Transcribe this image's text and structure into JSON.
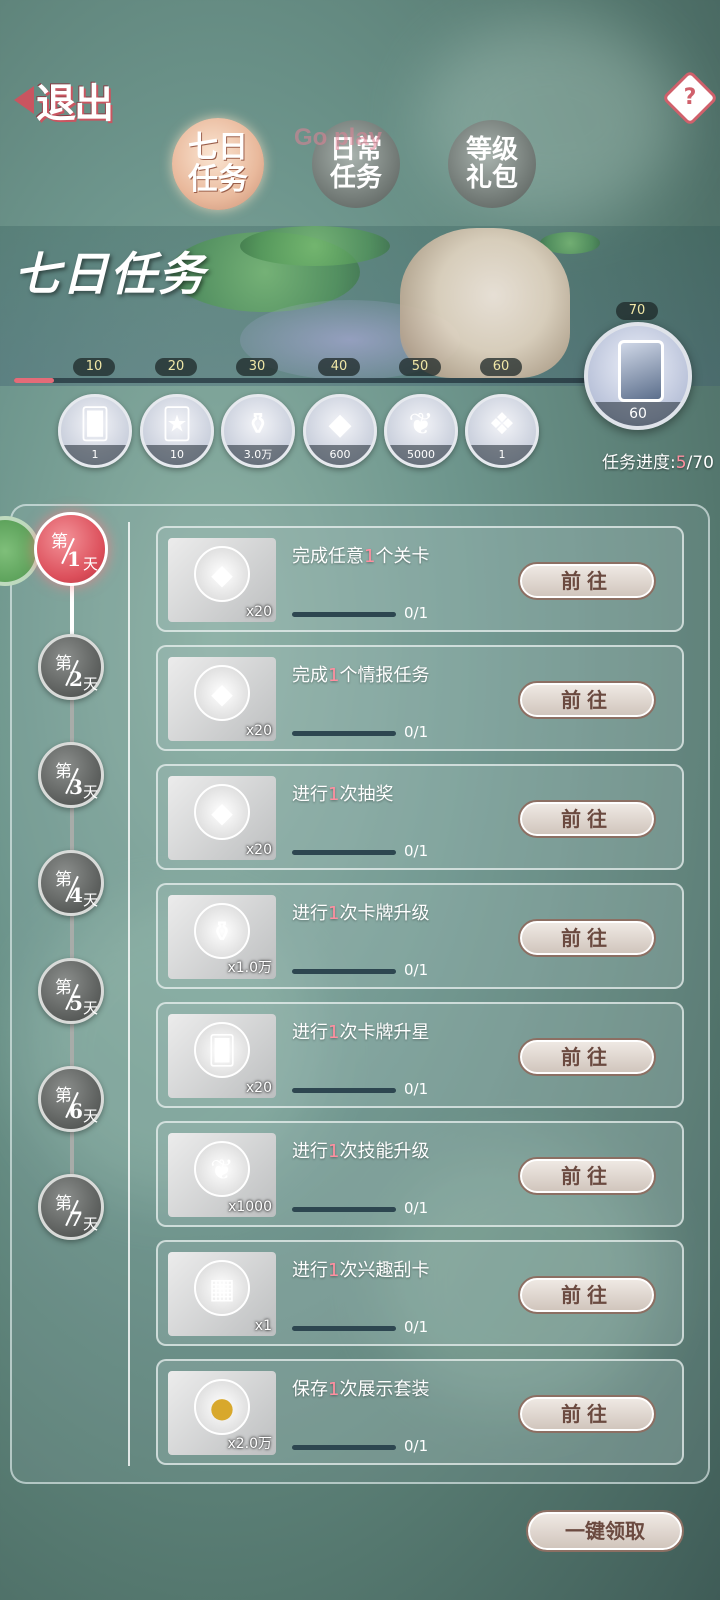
{
  "header": {
    "exit_label": "退出",
    "tabs": [
      {
        "label_line1": "七日",
        "label_line2": "任务",
        "active": true
      },
      {
        "label_line1": "日常",
        "label_line2": "任务",
        "active": false
      },
      {
        "label_line1": "等级",
        "label_line2": "礼包",
        "active": false
      }
    ],
    "watermark": "Go play",
    "help_icon": "?"
  },
  "banner": {
    "title": "七日任务",
    "milestones": [
      "10",
      "20",
      "30",
      "40",
      "50",
      "60"
    ],
    "final_milestone": "70",
    "progress_fraction": 0.07,
    "rewards": [
      {
        "icon": "card-icon",
        "count": "1"
      },
      {
        "icon": "tarot-card-icon",
        "count": "10"
      },
      {
        "icon": "perfume-bottle-icon",
        "count": "3.0万"
      },
      {
        "icon": "crystal-shoe-icon",
        "count": "600"
      },
      {
        "icon": "dragon-icon",
        "count": "5000"
      },
      {
        "icon": "outfit-icon",
        "count": "1"
      }
    ],
    "final_reward": {
      "icon": "card-pack-icon",
      "count": "60"
    },
    "progress_text_prefix": "任务进度:",
    "progress_current": "5",
    "progress_total": "/70"
  },
  "days": [
    {
      "di": "第",
      "num": "1",
      "tian": "天",
      "active": true
    },
    {
      "di": "第",
      "num": "2",
      "tian": "天",
      "active": false
    },
    {
      "di": "第",
      "num": "3",
      "tian": "天",
      "active": false
    },
    {
      "di": "第",
      "num": "4",
      "tian": "天",
      "active": false
    },
    {
      "di": "第",
      "num": "5",
      "tian": "天",
      "active": false
    },
    {
      "di": "第",
      "num": "6",
      "tian": "天",
      "active": false
    },
    {
      "di": "第",
      "num": "7",
      "tian": "天",
      "active": false
    }
  ],
  "tasks": [
    {
      "pre": "完成任意",
      "num": "1",
      "post": "个关卡",
      "qty": "x20",
      "icon": "crystal-shoe-icon",
      "count": "0/1",
      "button": "前往"
    },
    {
      "pre": "完成",
      "num": "1",
      "post": "个情报任务",
      "qty": "x20",
      "icon": "crystal-shoe-icon",
      "count": "0/1",
      "button": "前往"
    },
    {
      "pre": "进行",
      "num": "1",
      "post": "次抽奖",
      "qty": "x20",
      "icon": "crystal-shoe-icon",
      "count": "0/1",
      "button": "前往"
    },
    {
      "pre": "进行",
      "num": "1",
      "post": "次卡牌升级",
      "qty": "x1.0万",
      "icon": "perfume-bottle-icon",
      "count": "0/1",
      "button": "前往"
    },
    {
      "pre": "进行",
      "num": "1",
      "post": "次卡牌升星",
      "qty": "x20",
      "icon": "card-pack-icon",
      "count": "0/1",
      "button": "前往"
    },
    {
      "pre": "进行",
      "num": "1",
      "post": "次技能升级",
      "qty": "x1000",
      "icon": "dragon-icon",
      "count": "0/1",
      "button": "前往"
    },
    {
      "pre": "进行",
      "num": "1",
      "post": "次兴趣刮卡",
      "qty": "x1",
      "icon": "scratch-card-icon",
      "count": "0/1",
      "button": "前往"
    },
    {
      "pre": "保存",
      "num": "1",
      "post": "次展示套装",
      "qty": "x2.0万",
      "icon": "gold-coins-icon",
      "count": "0/1",
      "button": "前往"
    }
  ],
  "claim_all_label": "一键领取",
  "colors": {
    "accent": "#e46b78",
    "button_text": "#6b4a40",
    "highlight_text": "#ff8fa0"
  }
}
